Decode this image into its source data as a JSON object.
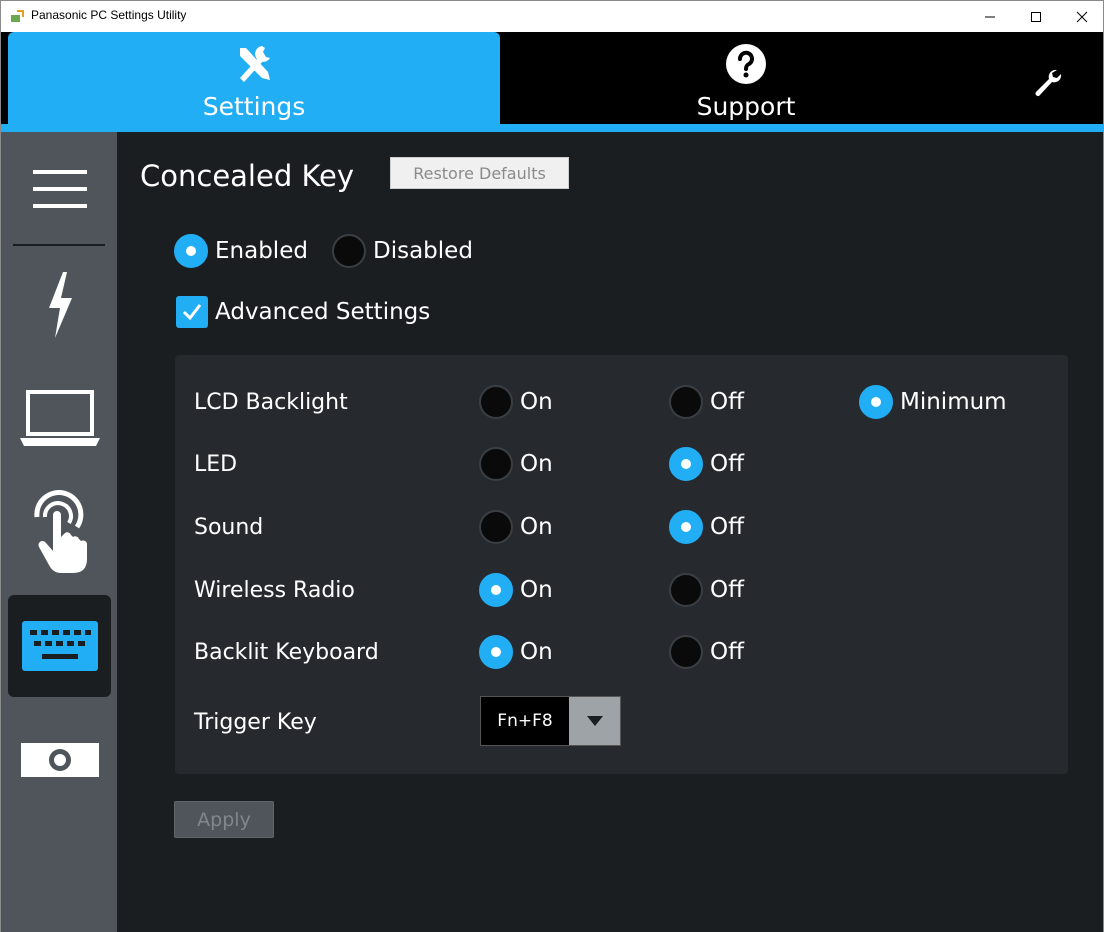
{
  "window": {
    "title": "Panasonic PC Settings Utility",
    "minimize_icon": "minimize-icon",
    "maximize_icon": "maximize-icon",
    "close_icon": "close-icon"
  },
  "tabs": [
    {
      "label": "Settings",
      "icon": "tools-icon",
      "active": true
    },
    {
      "label": "Support",
      "icon": "question-icon",
      "active": false
    }
  ],
  "sidebar": {
    "items": [
      {
        "icon": "hamburger-menu-icon",
        "active": false
      },
      {
        "icon": "power-bolt-icon",
        "active": false
      },
      {
        "icon": "laptop-icon",
        "active": false
      },
      {
        "icon": "touch-hand-icon",
        "active": false
      },
      {
        "icon": "keyboard-icon",
        "active": true
      },
      {
        "icon": "camera-icon",
        "active": false
      }
    ]
  },
  "main": {
    "title": "Concealed Key",
    "restore_label": "Restore Defaults",
    "enabled_label": "Enabled",
    "disabled_label": "Disabled",
    "enabled_selected": true,
    "advanced_label": "Advanced Settings",
    "advanced_checked": true,
    "rows": [
      {
        "label": "LCD Backlight",
        "options": [
          "On",
          "Off",
          "Minimum"
        ],
        "selected": "Minimum"
      },
      {
        "label": "LED",
        "options": [
          "On",
          "Off"
        ],
        "selected": "Off"
      },
      {
        "label": "Sound",
        "options": [
          "On",
          "Off"
        ],
        "selected": "Off"
      },
      {
        "label": "Wireless Radio",
        "options": [
          "On",
          "Off"
        ],
        "selected": "On"
      },
      {
        "label": "Backlit Keyboard",
        "options": [
          "On",
          "Off"
        ],
        "selected": "On"
      }
    ],
    "trigger_label": "Trigger Key",
    "trigger_value": "Fn+F8",
    "apply_label": "Apply"
  },
  "colors": {
    "accent": "#22aef5",
    "background": "#1b1e21",
    "sidebar": "#4f555b",
    "panel": "#262a2e"
  }
}
